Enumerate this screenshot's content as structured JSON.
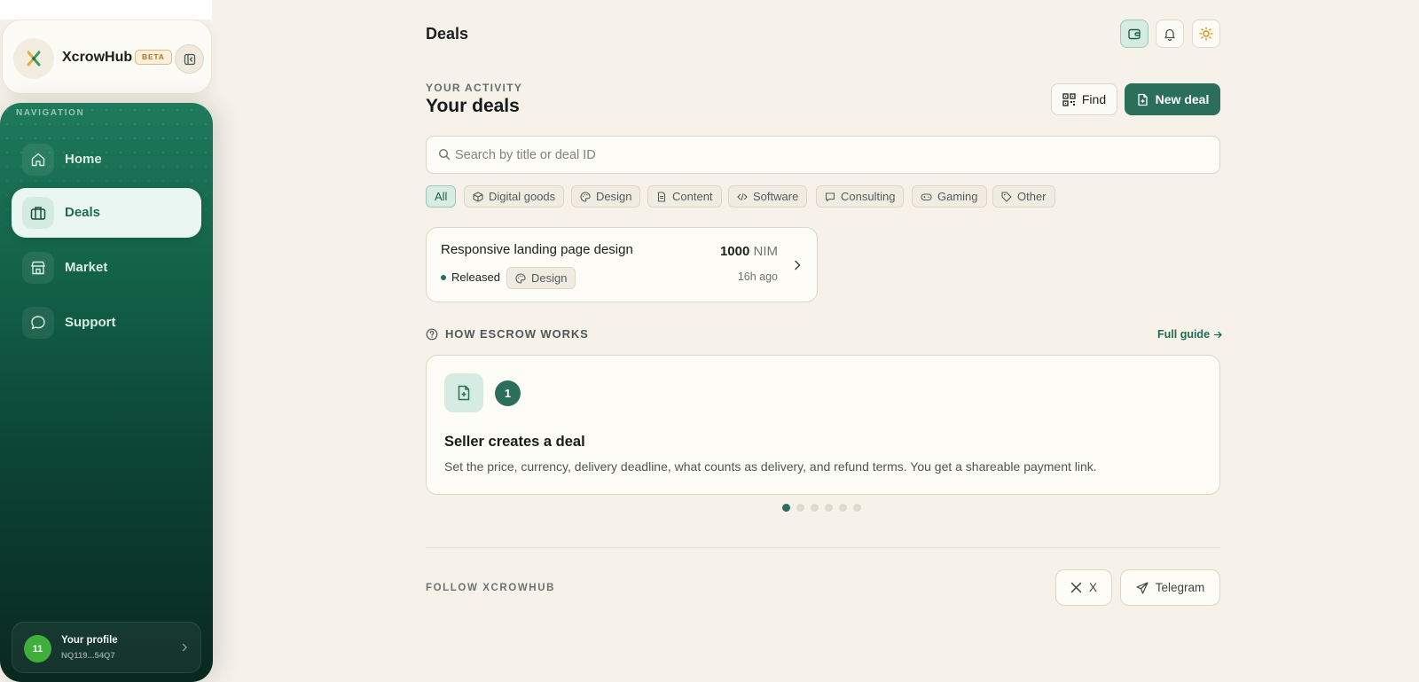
{
  "brand": {
    "name": "XcrowHub",
    "badge": "BETA",
    "collapse_icon": "sidebar-collapse-icon"
  },
  "sidebar": {
    "heading": "NAVIGATION",
    "items": [
      {
        "label": "Home",
        "icon": "home-icon",
        "active": false
      },
      {
        "label": "Deals",
        "icon": "briefcase-icon",
        "active": true
      },
      {
        "label": "Market",
        "icon": "store-icon",
        "active": false
      },
      {
        "label": "Support",
        "icon": "chat-bubble-icon",
        "active": false
      }
    ],
    "profile": {
      "avatar_text": "11",
      "name": "Your profile",
      "id": "NQ119...54Q7"
    }
  },
  "header": {
    "title": "Deals",
    "icons": [
      "wallet-icon",
      "bell-icon",
      "sun-icon"
    ]
  },
  "activity": {
    "eyebrow": "YOUR ACTIVITY",
    "title": "Your deals",
    "find_label": "Find",
    "new_deal_label": "New deal"
  },
  "search": {
    "placeholder": "Search by title or deal ID",
    "value": ""
  },
  "filters": [
    {
      "label": "All",
      "icon": "",
      "active": true
    },
    {
      "label": "Digital goods",
      "icon": "box-icon",
      "active": false
    },
    {
      "label": "Design",
      "icon": "palette-icon",
      "active": false
    },
    {
      "label": "Content",
      "icon": "document-icon",
      "active": false
    },
    {
      "label": "Software",
      "icon": "code-icon",
      "active": false
    },
    {
      "label": "Consulting",
      "icon": "message-icon",
      "active": false
    },
    {
      "label": "Gaming",
      "icon": "gamepad-icon",
      "active": false
    },
    {
      "label": "Other",
      "icon": "tag-icon",
      "active": false
    }
  ],
  "deals": [
    {
      "title": "Responsive landing page design",
      "status": "Released",
      "category": "Design",
      "amount": "1000",
      "currency": "NIM",
      "time": "16h ago"
    }
  ],
  "how": {
    "heading": "HOW ESCROW WORKS",
    "guide_label": "Full guide",
    "step": {
      "number": "1",
      "title": "Seller creates a deal",
      "description": "Set the price, currency, delivery deadline, what counts as delivery, and refund terms. You get a shareable payment link."
    },
    "total_steps": 6,
    "current_step": 1
  },
  "footer": {
    "follow_label": "FOLLOW XCROWHUB",
    "x_label": "X",
    "telegram_label": "Telegram"
  },
  "colors": {
    "background": "#f6f2ea",
    "accent": "#2b6f5b",
    "sidebar_top": "#1f7a5c",
    "sidebar_bottom": "#09281f",
    "beta_badge": "#b5732a",
    "avatar": "#3fae3a"
  }
}
